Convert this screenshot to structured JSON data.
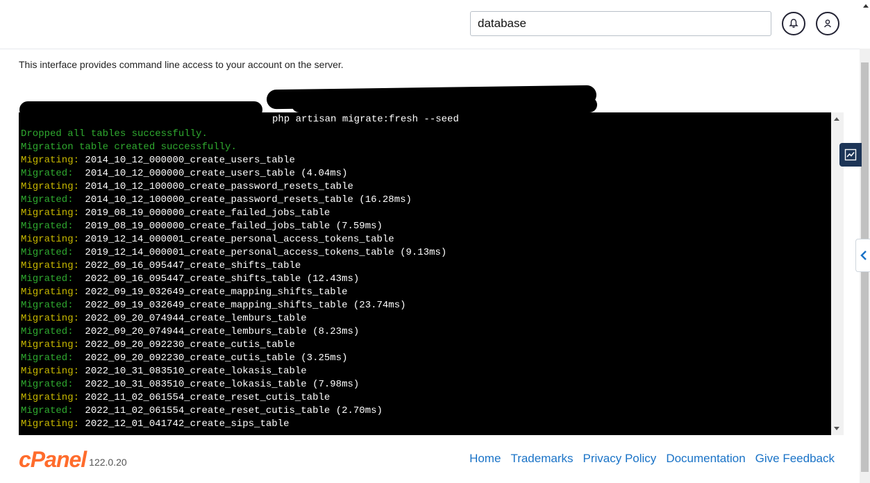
{
  "header": {
    "search_value": "database",
    "notifications_icon": "bell-icon",
    "user_icon": "user-icon"
  },
  "intro_text": "This interface provides command line access to your account on the server.",
  "terminal": {
    "command": "php artisan migrate:fresh --seed",
    "lines": [
      {
        "tag": "Dropped all tables successfully.",
        "text": "",
        "tag_color": "green"
      },
      {
        "tag": "Migration table created successfully.",
        "text": "",
        "tag_color": "green"
      },
      {
        "tag": "Migrating:",
        "text": " 2014_10_12_000000_create_users_table",
        "tag_color": "yellow"
      },
      {
        "tag": "Migrated:",
        "text": "  2014_10_12_000000_create_users_table (4.04ms)",
        "tag_color": "green"
      },
      {
        "tag": "Migrating:",
        "text": " 2014_10_12_100000_create_password_resets_table",
        "tag_color": "yellow"
      },
      {
        "tag": "Migrated:",
        "text": "  2014_10_12_100000_create_password_resets_table (16.28ms)",
        "tag_color": "green"
      },
      {
        "tag": "Migrating:",
        "text": " 2019_08_19_000000_create_failed_jobs_table",
        "tag_color": "yellow"
      },
      {
        "tag": "Migrated:",
        "text": "  2019_08_19_000000_create_failed_jobs_table (7.59ms)",
        "tag_color": "green"
      },
      {
        "tag": "Migrating:",
        "text": " 2019_12_14_000001_create_personal_access_tokens_table",
        "tag_color": "yellow"
      },
      {
        "tag": "Migrated:",
        "text": "  2019_12_14_000001_create_personal_access_tokens_table (9.13ms)",
        "tag_color": "green"
      },
      {
        "tag": "Migrating:",
        "text": " 2022_09_16_095447_create_shifts_table",
        "tag_color": "yellow"
      },
      {
        "tag": "Migrated:",
        "text": "  2022_09_16_095447_create_shifts_table (12.43ms)",
        "tag_color": "green"
      },
      {
        "tag": "Migrating:",
        "text": " 2022_09_19_032649_create_mapping_shifts_table",
        "tag_color": "yellow"
      },
      {
        "tag": "Migrated:",
        "text": "  2022_09_19_032649_create_mapping_shifts_table (23.74ms)",
        "tag_color": "green"
      },
      {
        "tag": "Migrating:",
        "text": " 2022_09_20_074944_create_lemburs_table",
        "tag_color": "yellow"
      },
      {
        "tag": "Migrated:",
        "text": "  2022_09_20_074944_create_lemburs_table (8.23ms)",
        "tag_color": "green"
      },
      {
        "tag": "Migrating:",
        "text": " 2022_09_20_092230_create_cutis_table",
        "tag_color": "yellow"
      },
      {
        "tag": "Migrated:",
        "text": "  2022_09_20_092230_create_cutis_table (3.25ms)",
        "tag_color": "green"
      },
      {
        "tag": "Migrating:",
        "text": " 2022_10_31_083510_create_lokasis_table",
        "tag_color": "yellow"
      },
      {
        "tag": "Migrated:",
        "text": "  2022_10_31_083510_create_lokasis_table (7.98ms)",
        "tag_color": "green"
      },
      {
        "tag": "Migrating:",
        "text": " 2022_11_02_061554_create_reset_cutis_table",
        "tag_color": "yellow"
      },
      {
        "tag": "Migrated:",
        "text": "  2022_11_02_061554_create_reset_cutis_table (2.70ms)",
        "tag_color": "green"
      },
      {
        "tag": "Migrating:",
        "text": " 2022_12_01_041742_create_sips_table",
        "tag_color": "yellow"
      }
    ]
  },
  "footer": {
    "logo_text": "cPanel",
    "version": "122.0.20",
    "links": [
      "Home",
      "Trademarks",
      "Privacy Policy",
      "Documentation",
      "Give Feedback"
    ]
  },
  "colors": {
    "green": "#2faa2f",
    "yellow": "#c7b800",
    "brand": "#ff6c2c",
    "link": "#1a73c7"
  }
}
